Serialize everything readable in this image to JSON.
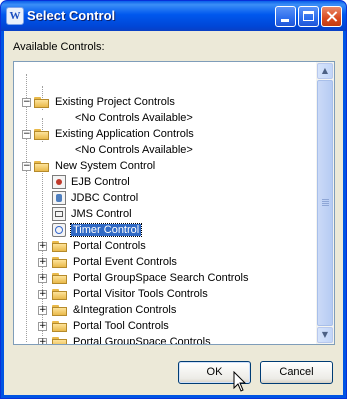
{
  "window": {
    "title": "Select Control",
    "app_icon": "W",
    "controls": [
      "minimize-icon",
      "maximize-icon",
      "close-icon"
    ]
  },
  "panel": {
    "label": "Available Controls:"
  },
  "tree": {
    "items": [
      {
        "label": "Existing Project Controls",
        "icon": "folder-icon",
        "expanded": true
      },
      {
        "label": "<No Controls Available>",
        "icon": null
      },
      {
        "label": "Existing Application Controls",
        "icon": "folder-icon",
        "expanded": true
      },
      {
        "label": "<No Controls Available>",
        "icon": null
      },
      {
        "label": "New System Control",
        "icon": "folder-icon",
        "expanded": true
      },
      {
        "label": "EJB Control",
        "icon": "ejb-icon"
      },
      {
        "label": "JDBC Control",
        "icon": "jdbc-icon"
      },
      {
        "label": "JMS Control",
        "icon": "jms-icon"
      },
      {
        "label": "Timer Control",
        "icon": "timer-icon",
        "selected": true
      },
      {
        "label": "Portal Controls",
        "icon": "folder-icon",
        "expanded": false
      },
      {
        "label": "Portal Event Controls",
        "icon": "folder-icon",
        "expanded": false
      },
      {
        "label": "Portal GroupSpace Search Controls",
        "icon": "folder-icon",
        "expanded": false
      },
      {
        "label": "Portal Visitor Tools Controls",
        "icon": "folder-icon",
        "expanded": false
      },
      {
        "label": "&Integration Controls",
        "icon": "folder-icon",
        "expanded": false
      },
      {
        "label": "Portal Tool Controls",
        "icon": "folder-icon",
        "expanded": false
      },
      {
        "label": "Portal GroupSpace Controls",
        "icon": "folder-icon",
        "expanded": false
      }
    ]
  },
  "buttons": {
    "ok": "OK",
    "cancel": "Cancel"
  },
  "colors": {
    "titlebar": "#0054e3",
    "selection": "#316ac5",
    "dialog_bg": "#ece9d8"
  }
}
